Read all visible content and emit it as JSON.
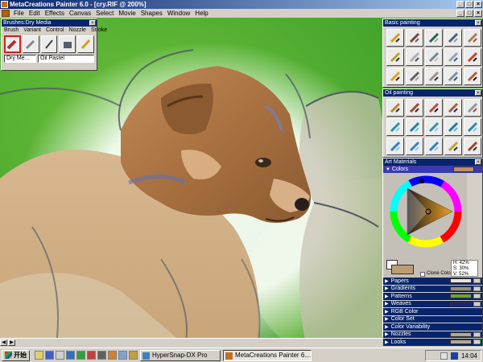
{
  "window": {
    "title": "MetaCreations Painter 6.0 - [cry.RIF @ 200%]",
    "controls": [
      "_",
      "□",
      "×"
    ]
  },
  "menubar": {
    "items": [
      "File",
      "Edit",
      "Effects",
      "Canvas",
      "Select",
      "Movie",
      "Shapes",
      "Window",
      "Help"
    ]
  },
  "brushes_palette": {
    "title": "Brushes:Dry Media",
    "menu": [
      "Brush",
      "Variant",
      "Control",
      "Nozzle",
      "Stroke"
    ],
    "variant_left": "Dry Me...",
    "variant_right": "Oil Pastel"
  },
  "basic_painting": {
    "title": "Basic painting"
  },
  "oil_painting": {
    "title": "Oil painting"
  },
  "art_materials": {
    "title": "Art Materials",
    "colors_label": "Colors",
    "hsv": {
      "h": "H: 42%",
      "s": "S: 30%",
      "v": "V: 52%"
    },
    "clone_color": "Clone Color",
    "primary_color": "#bd9c74",
    "sections": [
      {
        "label": "Papers",
        "swatch": "#e8e4dc"
      },
      {
        "label": "Gradients",
        "swatch": "#9a9080"
      },
      {
        "label": "Patterns",
        "swatch": "#6aa040"
      },
      {
        "label": "Weaves",
        "swatch": "#202080"
      },
      {
        "label": "RGB Color",
        "swatch": ""
      },
      {
        "label": "Color Set",
        "swatch": ""
      },
      {
        "label": "Color Variability",
        "swatch": ""
      },
      {
        "label": "Nozzles",
        "swatch": "#b0a890"
      },
      {
        "label": "Looks",
        "swatch": "#b0a890"
      }
    ]
  },
  "taskbar": {
    "start_label": "开始",
    "tasks": [
      "HyperSnap-DX Pro",
      "MetaCreations Painter 6...."
    ],
    "clock": "14:04"
  },
  "colors": {
    "title_bar": "#08246b",
    "palette_bg": "#d4d0c8",
    "grass": "#3f9f28",
    "fur": "#b07a48"
  }
}
